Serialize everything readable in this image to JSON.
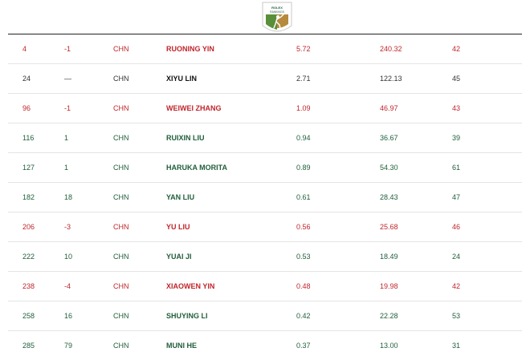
{
  "colors": {
    "down": "#c0252b",
    "up": "#1f5e3a",
    "same": "#333333",
    "badge_green": "#5a8f3a",
    "badge_gold": "#b68a3c"
  },
  "badge": {
    "brand": "ROLEX",
    "caption": "RANKINGS",
    "icon": "golfer-icon"
  },
  "rows": [
    {
      "rank": "4",
      "move": "-1",
      "country": "CHN",
      "name": "RUONING YIN",
      "avg": "5.72",
      "points": "240.32",
      "events": "42",
      "trend": "down"
    },
    {
      "rank": "24",
      "move": "—",
      "country": "CHN",
      "name": "XIYU LIN",
      "avg": "2.71",
      "points": "122.13",
      "events": "45",
      "trend": "same"
    },
    {
      "rank": "96",
      "move": "-1",
      "country": "CHN",
      "name": "WEIWEI ZHANG",
      "avg": "1.09",
      "points": "46.97",
      "events": "43",
      "trend": "down"
    },
    {
      "rank": "116",
      "move": "1",
      "country": "CHN",
      "name": "RUIXIN LIU",
      "avg": "0.94",
      "points": "36.67",
      "events": "39",
      "trend": "up"
    },
    {
      "rank": "127",
      "move": "1",
      "country": "CHN",
      "name": "HARUKA MORITA",
      "avg": "0.89",
      "points": "54.30",
      "events": "61",
      "trend": "up"
    },
    {
      "rank": "182",
      "move": "18",
      "country": "CHN",
      "name": "YAN LIU",
      "avg": "0.61",
      "points": "28.43",
      "events": "47",
      "trend": "up"
    },
    {
      "rank": "206",
      "move": "-3",
      "country": "CHN",
      "name": "YU LIU",
      "avg": "0.56",
      "points": "25.68",
      "events": "46",
      "trend": "down"
    },
    {
      "rank": "222",
      "move": "10",
      "country": "CHN",
      "name": "YUAI JI",
      "avg": "0.53",
      "points": "18.49",
      "events": "24",
      "trend": "up"
    },
    {
      "rank": "238",
      "move": "-4",
      "country": "CHN",
      "name": "XIAOWEN YIN",
      "avg": "0.48",
      "points": "19.98",
      "events": "42",
      "trend": "down"
    },
    {
      "rank": "258",
      "move": "16",
      "country": "CHN",
      "name": "SHUYING LI",
      "avg": "0.42",
      "points": "22.28",
      "events": "53",
      "trend": "up"
    },
    {
      "rank": "285",
      "move": "79",
      "country": "CHN",
      "name": "MUNI HE",
      "avg": "0.37",
      "points": "13.00",
      "events": "31",
      "trend": "up"
    }
  ]
}
